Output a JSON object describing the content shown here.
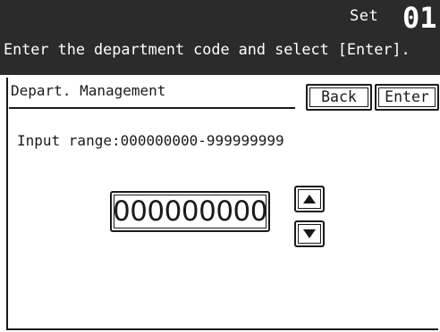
{
  "header": {
    "set_label": "Set",
    "set_number": "01",
    "instruction": "Enter the department code and select [Enter]."
  },
  "panel": {
    "title": "Depart. Management",
    "back_label": "Back",
    "enter_label": "Enter",
    "input_range": "Input range:000000000-999999999",
    "code_value": "000000000"
  },
  "icons": {
    "up": "arrow-up-icon",
    "down": "arrow-down-icon"
  },
  "colors": {
    "header_bg": "#2b2b2b",
    "header_text": "#ffffff",
    "foreground": "#1a1a1a",
    "background": "#ffffff"
  }
}
